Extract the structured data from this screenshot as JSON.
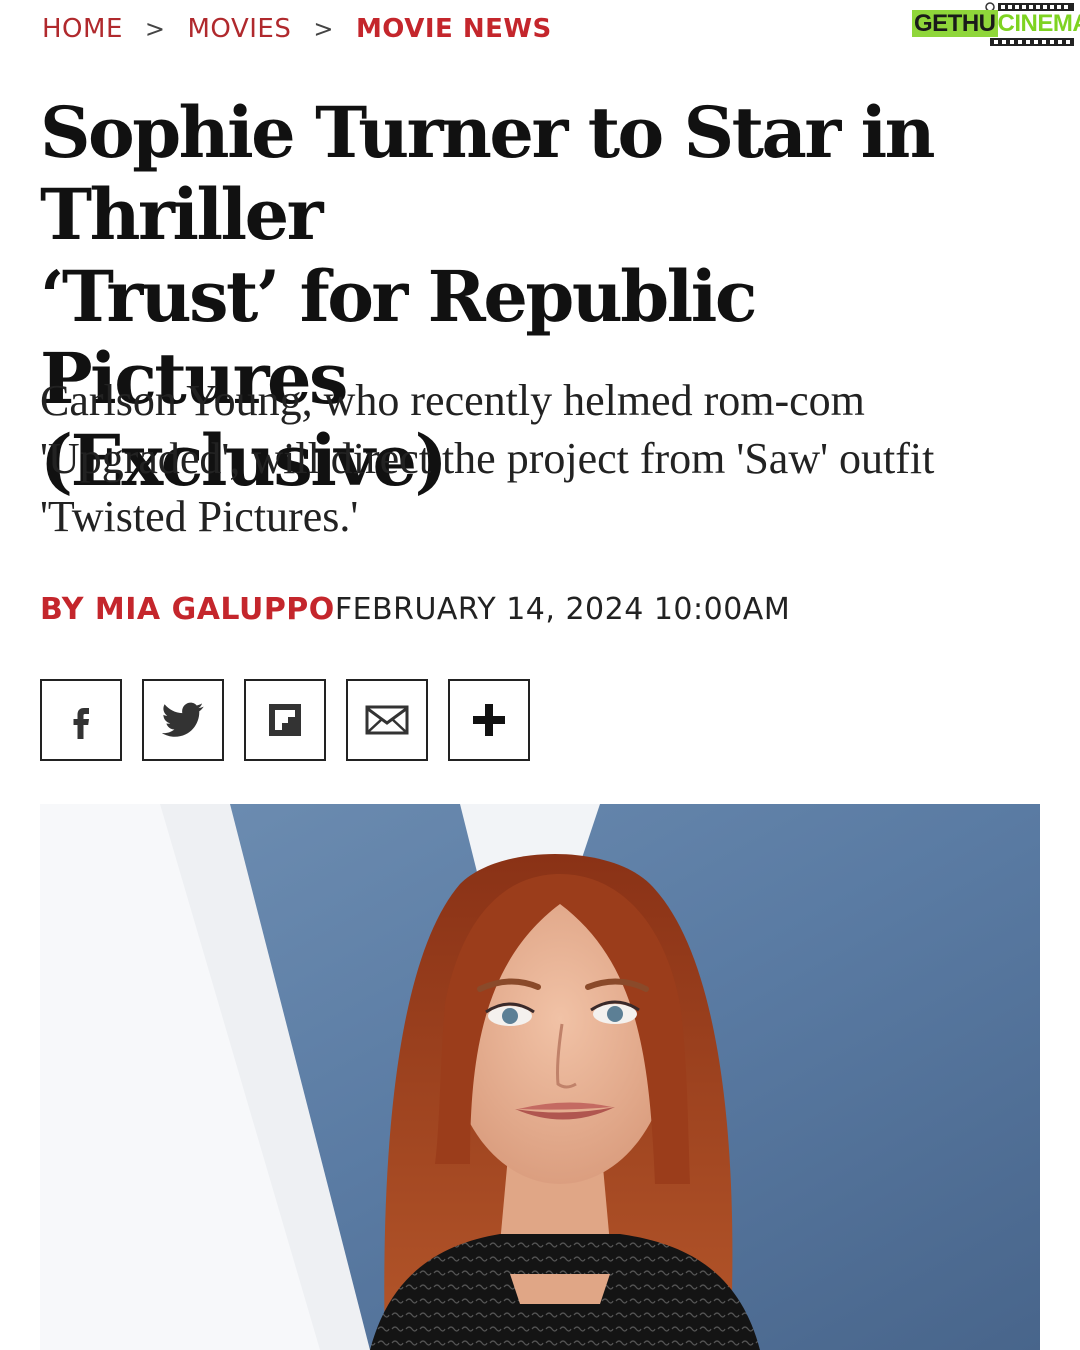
{
  "breadcrumb": {
    "items": [
      "HOME",
      "MOVIES"
    ],
    "current": "MOVIE NEWS",
    "separator": ">"
  },
  "logo": {
    "part1": "GETHU",
    "part2": "CINEMA"
  },
  "article": {
    "title_lines": [
      "Sophie Turner to Star in Thriller",
      "‘Trust’ for Republic Pictures",
      "(Exclusive)"
    ],
    "dek_lines": [
      "Carlson Young, who recently helmed rom-com",
      "'Upgraded', will direct the project from 'Saw' outfit",
      "'Twisted Pictures.'"
    ],
    "byline_author": "BY MIA GALUPPO",
    "byline_date": "FEBRUARY 14, 2024 10:00AM"
  },
  "share_buttons": [
    "facebook-icon",
    "twitter-icon",
    "flipboard-icon",
    "email-icon",
    "plus-icon"
  ],
  "colors": {
    "accent": "#c4262c",
    "text": "#111111",
    "logo_green": "#7ed321"
  }
}
